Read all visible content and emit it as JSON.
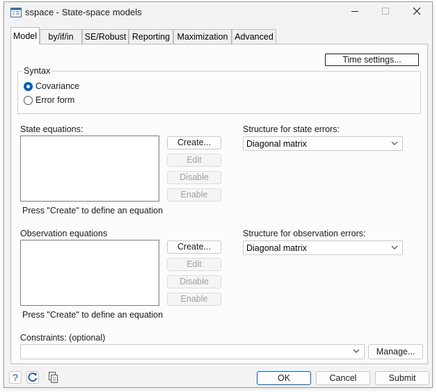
{
  "window": {
    "title": "sspace - State-space models",
    "minimize_glyph": "—",
    "maximize_glyph": "☐",
    "close_glyph": "✕"
  },
  "tabs": [
    {
      "label": "Model",
      "active": true
    },
    {
      "label": "by/if/in"
    },
    {
      "label": "SE/Robust"
    },
    {
      "label": "Reporting"
    },
    {
      "label": "Maximization"
    },
    {
      "label": "Advanced"
    }
  ],
  "model": {
    "time_settings_label": "Time settings...",
    "syntax": {
      "legend": "Syntax",
      "options": [
        "Covariance",
        "Error form"
      ],
      "selected": "Covariance"
    },
    "state": {
      "label": "State equations:",
      "create_label": "Create...",
      "edit_label": "Edit",
      "disable_label": "Disable",
      "enable_label": "Enable",
      "hint": "Press \"Create\" to define an equation",
      "structure_label": "Structure for state errors:",
      "structure_value": "Diagonal matrix"
    },
    "observation": {
      "label": "Observation equations",
      "create_label": "Create...",
      "edit_label": "Edit",
      "disable_label": "Disable",
      "enable_label": "Enable",
      "hint": "Press \"Create\" to define an equation",
      "structure_label": "Structure for observation errors:",
      "structure_value": "Diagonal matrix"
    },
    "constraints": {
      "label": "Constraints: (optional)",
      "value": "",
      "manage_label": "Manage..."
    }
  },
  "footer": {
    "help_icon": "question-icon",
    "reset_icon": "refresh-icon",
    "copy_icon": "copy-icon",
    "ok_label": "OK",
    "cancel_label": "Cancel",
    "submit_label": "Submit"
  },
  "colors": {
    "accent": "#005fb8",
    "window_bg": "#f3f3f3",
    "panel_bg": "#fcfcfc"
  }
}
